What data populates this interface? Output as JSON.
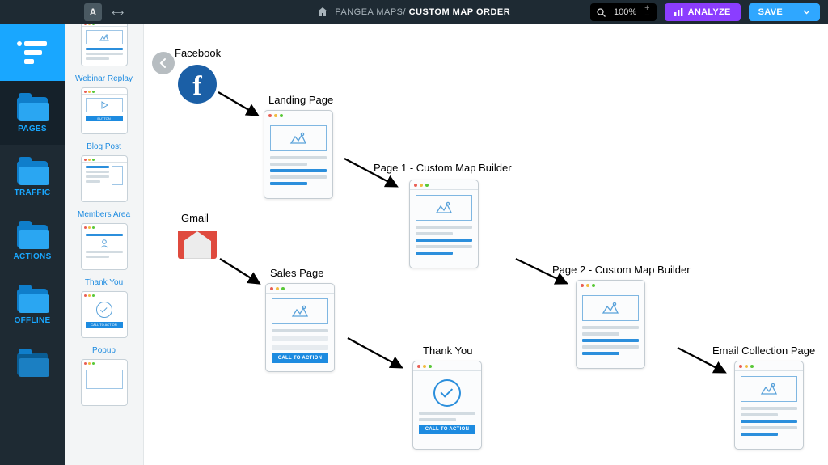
{
  "topbar": {
    "text_tool": "A",
    "breadcrumb_parent": "PANGEA MAPS",
    "breadcrumb_sep": "/ ",
    "breadcrumb_current": "CUSTOM MAP ORDER",
    "zoom_label": "100%",
    "analyze_label": "ANALYZE",
    "save_label": "SAVE"
  },
  "rail": [
    {
      "key": "pages",
      "label": "PAGES"
    },
    {
      "key": "traffic",
      "label": "TRAFFIC"
    },
    {
      "key": "actions",
      "label": "ACTIONS"
    },
    {
      "key": "offline",
      "label": "OFFLINE"
    }
  ],
  "library": [
    {
      "label": "",
      "variant": "generic"
    },
    {
      "label": "Webinar Replay",
      "variant": "video"
    },
    {
      "label": "Blog Post",
      "variant": "post"
    },
    {
      "label": "Members Area",
      "variant": "members"
    },
    {
      "label": "Thank You",
      "variant": "thankyou"
    },
    {
      "label": "Popup",
      "variant": "popup"
    }
  ],
  "canvas": {
    "sources": {
      "facebook": "Facebook",
      "gmail": "Gmail"
    },
    "nodes": {
      "landing": "Landing Page",
      "page1": "Page 1 - Custom Map Builder",
      "sales": "Sales Page",
      "page2": "Page 2 - Custom Map Builder",
      "thankyou": "Thank You",
      "email": "Email Collection Page"
    },
    "cta_text": "CALL TO ACTION"
  }
}
